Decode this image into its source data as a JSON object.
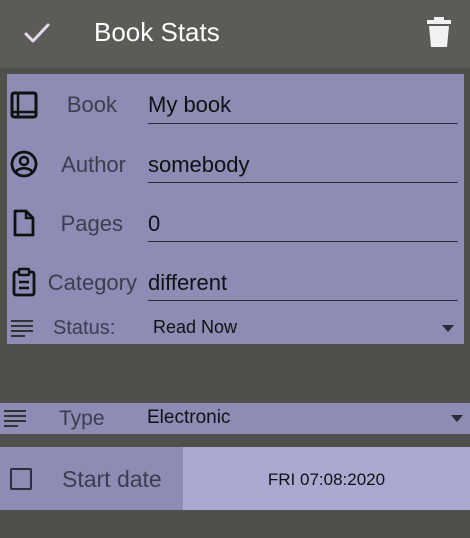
{
  "toolbar": {
    "confirm_icon": "check-icon",
    "title": "Book Stats",
    "delete_icon": "trash-icon"
  },
  "form": {
    "book": {
      "icon": "book-icon",
      "label": "Book",
      "value": "My book"
    },
    "author": {
      "icon": "person-circle-icon",
      "label": "Author",
      "value": "somebody"
    },
    "pages": {
      "icon": "document-icon",
      "label": "Pages",
      "value": "0"
    },
    "category": {
      "icon": "clipboard-icon",
      "label": "Category",
      "value": "different"
    },
    "status": {
      "icon": "list-icon",
      "label": "Status:",
      "value": "Read Now"
    }
  },
  "type": {
    "icon": "list-icon",
    "label": "Type",
    "value": "Electronic"
  },
  "start_date": {
    "label": "Start date",
    "value": "FRI 07:08:2020",
    "checked": false
  },
  "colors": {
    "background": "#4f4f4b",
    "toolbar": "#5b5b57",
    "panel": "#8c8cb4",
    "date_button": "#a9a9d2"
  }
}
